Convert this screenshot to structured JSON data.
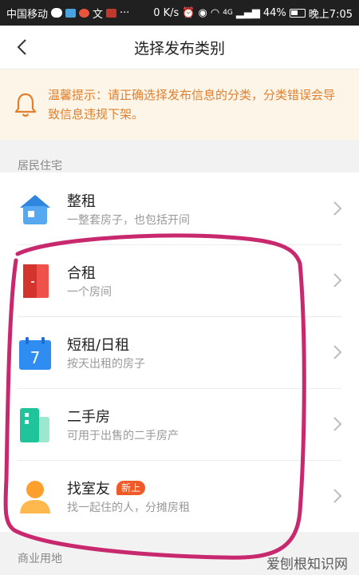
{
  "status_bar": {
    "carrier": "中国移动",
    "app_text": "文",
    "signal_gen": "4G",
    "speed": "0 K/s",
    "battery": "44%",
    "time": "晚上7:05"
  },
  "nav": {
    "title": "选择发布类别"
  },
  "notice": {
    "text": "温馨提示：请正确选择发布信息的分类，分类错误会导致信息违规下架。"
  },
  "sections": {
    "residential": "居民住宅",
    "commercial": "商业用地"
  },
  "items": [
    {
      "title": "整租",
      "subtitle": "一整套房子，也包括开间",
      "icon": "house-icon"
    },
    {
      "title": "合租",
      "subtitle": "一个房间",
      "icon": "door-icon"
    },
    {
      "title": "短租/日租",
      "subtitle": "按天出租的房子",
      "icon": "calendar-icon",
      "calendar_day": "7"
    },
    {
      "title": "二手房",
      "subtitle": "可用于出售的二手房产",
      "icon": "building-icon"
    },
    {
      "title": "找室友",
      "subtitle": "找一起住的人，分摊房租",
      "icon": "person-icon",
      "badge": "新上"
    }
  ],
  "watermark": "爱刨根知识网",
  "colors": {
    "accent": "#f05a28",
    "notice_text": "#e0802f",
    "annotation": "#c8286e"
  }
}
